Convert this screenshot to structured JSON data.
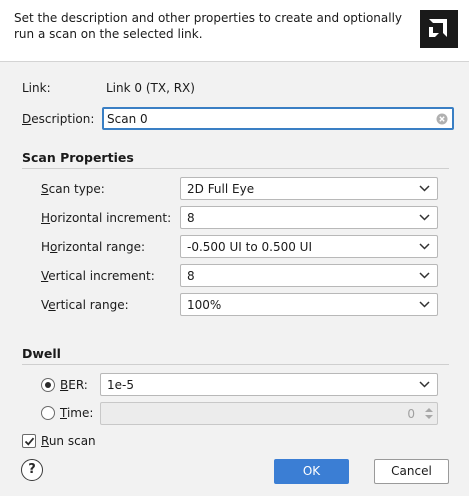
{
  "header": {
    "text": "Set the description and other properties to create and optionally run a scan on the selected link."
  },
  "link": {
    "label": "Link:",
    "value": "Link 0 (TX, RX)"
  },
  "description": {
    "label_u": "D",
    "label_rest": "escription:",
    "value": "Scan 0"
  },
  "scan_properties": {
    "title": "Scan Properties",
    "scan_type": {
      "label_u": "S",
      "label_rest": "can type:",
      "value": "2D Full Eye"
    },
    "horizontal_increment": {
      "label_u": "H",
      "label_rest": "orizontal increment:",
      "value": "8"
    },
    "horizontal_range": {
      "label_pre": "H",
      "label_u": "o",
      "label_rest": "rizontal range:",
      "value": "-0.500 UI to 0.500 UI"
    },
    "vertical_increment": {
      "label_u": "V",
      "label_rest": "ertical increment:",
      "value": "8"
    },
    "vertical_range": {
      "label_pre": "V",
      "label_u": "e",
      "label_rest": "rtical range:",
      "value": "100%"
    }
  },
  "dwell": {
    "title": "Dwell",
    "ber": {
      "label_u": "B",
      "label_rest": "ER:",
      "value": "1e-5",
      "selected": true
    },
    "time": {
      "label_u": "T",
      "label_rest": "ime:",
      "value": "0",
      "selected": false
    }
  },
  "run_scan": {
    "label_u": "R",
    "label_rest": "un scan",
    "checked": true
  },
  "buttons": {
    "help": "?",
    "ok": "OK",
    "cancel": "Cancel"
  },
  "colors": {
    "accent": "#3b7ed4",
    "focus_border": "#3a7fc4",
    "background": "#f2f2f2"
  },
  "icons": {
    "logo": "amd-logo",
    "clear": "clear-icon",
    "dropdown": "chevron-down-icon",
    "spinner": "spinner-arrows-icon",
    "help": "help-icon"
  }
}
